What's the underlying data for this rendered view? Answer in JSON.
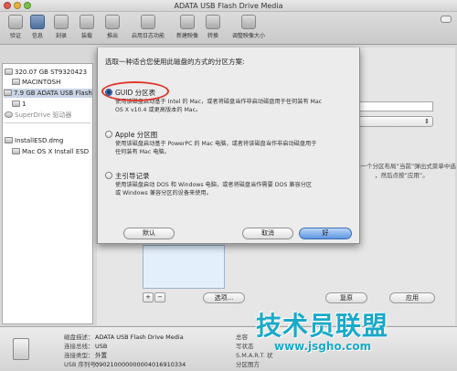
{
  "window": {
    "title": "ADATA USB Flash Drive Media"
  },
  "toolbar": {
    "items": [
      "验证",
      "信息",
      "刻录",
      "装载",
      "推出",
      "启用日志功能",
      "新建映像",
      "转换",
      "调整映像大小"
    ]
  },
  "sidebar": {
    "items": [
      {
        "label": "320.07 GB ST9320423",
        "type": "disk"
      },
      {
        "label": "MACINTOSH",
        "type": "volume"
      },
      {
        "label": "7.9 GB ADATA USB Flash",
        "type": "disk"
      },
      {
        "label": "1",
        "type": "volume"
      },
      {
        "label": "SuperDrive 驱动器",
        "type": "optical"
      },
      {
        "label": "InstallESD.dmg",
        "type": "image"
      },
      {
        "label": "Mac OS X Install ESD",
        "type": "volume"
      }
    ]
  },
  "sheet": {
    "prompt": "选取一种适合您使用此磁盘的方式的分区方案:",
    "options": [
      {
        "label": "GUID 分区表",
        "desc": "使用该磁盘启动基于 Intel 的 Mac，或者将磁盘当作非启动磁盘用于任何装有 Mac\nOS X v10.4 或更高版本的 Mac。",
        "selected": true
      },
      {
        "label": "Apple 分区图",
        "desc": "使用该磁盘启动基于 PowerPC 的 Mac 电脑，或者将该磁盘当作非启动磁盘用于\n任何装有 Mac 电脑。",
        "selected": false
      },
      {
        "label": "主引导记录",
        "desc": "使用该磁盘启动 DOS 和 Windows 电脑，或者将磁盘当作需要 DOS 兼容分区\n或 Windows 兼容分区的设备来使用。",
        "selected": false
      }
    ],
    "buttons": {
      "default": "默认",
      "cancel": "取消",
      "ok": "好"
    }
  },
  "main": {
    "right_text_1": "择一个分区布局“当前”弹出式菜单中选",
    "right_text_2": "，然后点按“应用”。",
    "options_button": "选项...",
    "revert_button": "复原",
    "apply_button": "应用",
    "plus": "+",
    "minus": "−"
  },
  "info": {
    "rows": [
      {
        "k": "磁盘描述：",
        "v": "ADATA USB Flash Drive Media"
      },
      {
        "k": "连接总线：",
        "v": "USB"
      },
      {
        "k": "连接类型：",
        "v": "外置"
      },
      {
        "k": "USB 序列号：",
        "v": "09021000000000401691033​4"
      }
    ],
    "right_rows": [
      "总容",
      "写状态",
      "S.M.A.R.T. 状",
      "分区图方"
    ]
  },
  "watermark": {
    "text": "技术员联盟",
    "url": "www.jsgho.com"
  }
}
